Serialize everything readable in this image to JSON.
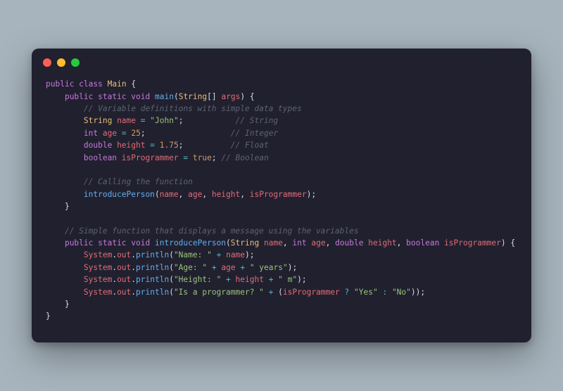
{
  "code": {
    "l1": {
      "kw_public": "public",
      "kw_class": "class",
      "cls": "Main",
      "brace": "{"
    },
    "l2": {
      "kw_public": "public",
      "kw_static": "static",
      "type_void": "void",
      "fn": "main",
      "lp": "(",
      "type_arr": "String",
      "brackets": "[]",
      "arg": "args",
      "rp": ")",
      "brace": "{"
    },
    "l3": {
      "cm": "// Variable definitions with simple data types"
    },
    "l4": {
      "type": "String",
      "var": "name",
      "eq": "=",
      "str": "\"John\"",
      "semi": ";",
      "pad": "           ",
      "cm": "// String"
    },
    "l5": {
      "type": "int",
      "var": "age",
      "eq": "=",
      "num": "25",
      "semi": ";",
      "pad": "                  ",
      "cm": "// Integer"
    },
    "l6": {
      "type": "double",
      "var": "height",
      "eq": "=",
      "num": "1.75",
      "semi": ";",
      "pad": "          ",
      "cm": "// Float"
    },
    "l7": {
      "type": "boolean",
      "var": "isProgrammer",
      "eq": "=",
      "bool": "true",
      "semi": ";",
      "pad": " ",
      "cm": "// Boolean"
    },
    "l9": {
      "cm": "// Calling the function"
    },
    "l10": {
      "fn": "introducePerson",
      "lp": "(",
      "a1": "name",
      "c1": ", ",
      "a2": "age",
      "c2": ", ",
      "a3": "height",
      "c3": ", ",
      "a4": "isProgrammer",
      "rp": ")",
      "semi": ";"
    },
    "l11": {
      "brace": "}"
    },
    "l13": {
      "cm": "// Simple function that displays a message using the variables"
    },
    "l14": {
      "kw_public": "public",
      "kw_static": "static",
      "type_void": "void",
      "fn": "introducePerson",
      "lp": "(",
      "t1": "String",
      "p1": "name",
      "c1": ", ",
      "t2": "int",
      "p2": "age",
      "c2": ", ",
      "t3": "double",
      "p3": "height",
      "c3": ", ",
      "t4": "boolean",
      "p4": "isProgrammer",
      "rp": ")",
      "brace": "{"
    },
    "l15": {
      "sys": "System",
      "dot1": ".",
      "out": "out",
      "dot2": ".",
      "fn": "println",
      "lp": "(",
      "s1": "\"Name: \"",
      "op": "+",
      "v": "name",
      "rp": ")",
      "semi": ";"
    },
    "l16": {
      "sys": "System",
      "dot1": ".",
      "out": "out",
      "dot2": ".",
      "fn": "println",
      "lp": "(",
      "s1": "\"Age: \"",
      "op1": "+",
      "v": "age",
      "op2": "+",
      "s2": "\" years\"",
      "rp": ")",
      "semi": ";"
    },
    "l17": {
      "sys": "System",
      "dot1": ".",
      "out": "out",
      "dot2": ".",
      "fn": "println",
      "lp": "(",
      "s1": "\"Height: \"",
      "op1": "+",
      "v": "height",
      "op2": "+",
      "s2": "\" m\"",
      "rp": ")",
      "semi": ";"
    },
    "l18": {
      "sys": "System",
      "dot1": ".",
      "out": "out",
      "dot2": ".",
      "fn": "println",
      "lp": "(",
      "s1": "\"Is a programmer? \"",
      "op": "+",
      "lpp": "(",
      "v": "isProgrammer",
      "q": "?",
      "sy": "\"Yes\"",
      "col": ":",
      "sn": "\"No\"",
      "rpp": ")",
      "rp": ")",
      "semi": ";"
    },
    "l19": {
      "brace": "}"
    },
    "l20": {
      "brace": "}"
    }
  }
}
